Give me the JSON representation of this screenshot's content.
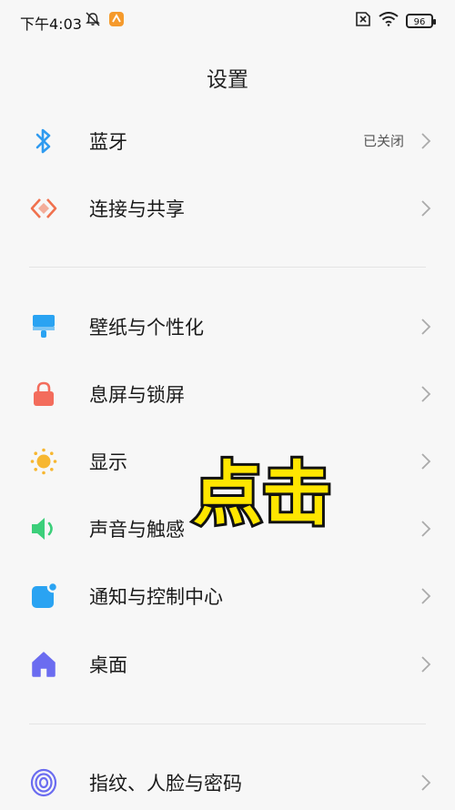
{
  "status_bar": {
    "time": "下午4:03",
    "battery": "96"
  },
  "header": {
    "title": "设置"
  },
  "sections": [
    {
      "items": [
        {
          "label": "蓝牙",
          "value": "已关闭",
          "icon": "bluetooth-icon",
          "color": "#2f9bf0"
        },
        {
          "label": "连接与共享",
          "value": "",
          "icon": "share-icon",
          "color": "#f0714e"
        }
      ]
    },
    {
      "items": [
        {
          "label": "壁纸与个性化",
          "icon": "brush-icon",
          "color": "#2aa3f2"
        },
        {
          "label": "息屏与锁屏",
          "icon": "lock-icon",
          "color": "#f36c5c"
        },
        {
          "label": "显示",
          "icon": "sun-icon",
          "color": "#f7b731"
        },
        {
          "label": "声音与触感",
          "icon": "speaker-icon",
          "color": "#3ccf7a"
        },
        {
          "label": "通知与控制中心",
          "icon": "notification-icon",
          "color": "#2aa3f2"
        },
        {
          "label": "桌面",
          "icon": "home-icon",
          "color": "#6b6cf0"
        }
      ]
    },
    {
      "items": [
        {
          "label": "指纹、人脸与密码",
          "icon": "fingerprint-icon",
          "color": "#6b6cf0"
        }
      ]
    }
  ],
  "overlay": {
    "text": "点击"
  }
}
